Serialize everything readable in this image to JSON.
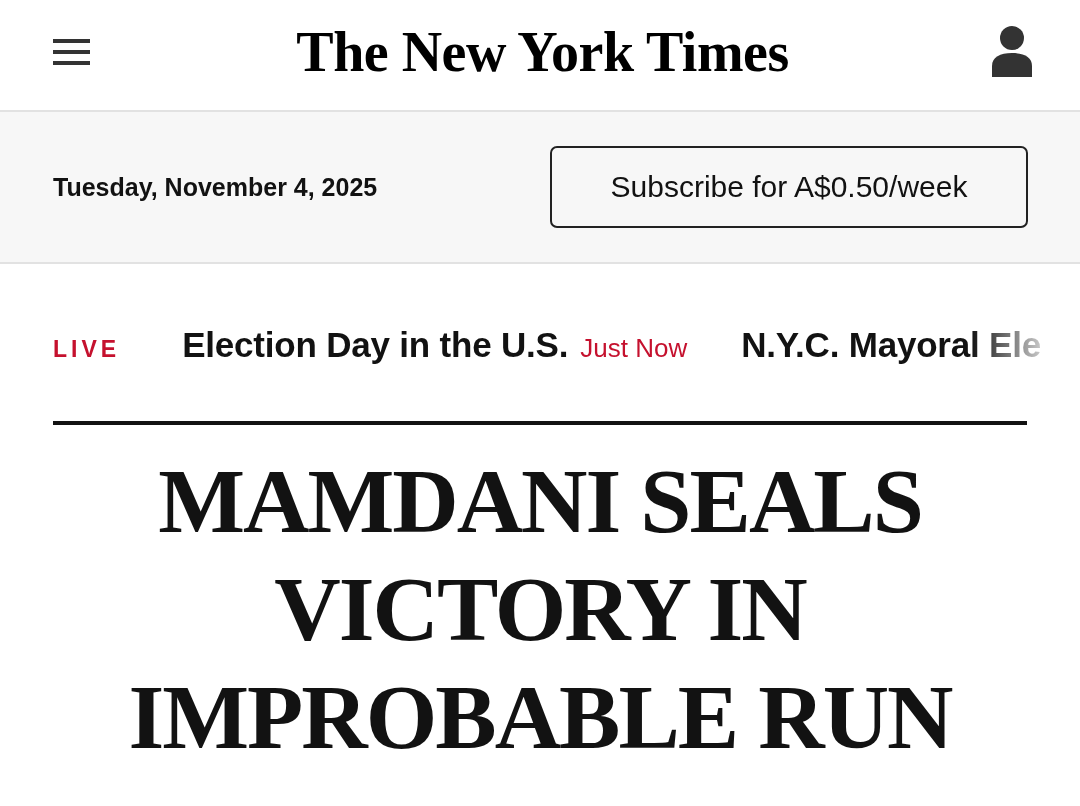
{
  "header": {
    "logo": "The New York Times"
  },
  "subheader": {
    "date": "Tuesday, November 4, 2025",
    "subscribe_button": "Subscribe for A$0.50/week"
  },
  "live_bar": {
    "badge": "LIVE",
    "items": [
      {
        "title": "Election Day in the U.S.",
        "time": "Just Now",
        "faded": false
      },
      {
        "title": "N.Y.C. Mayoral Ele",
        "faded": true
      }
    ]
  },
  "headline": "MAMDANI SEALS VICTORY IN IMPROBABLE RUN"
}
